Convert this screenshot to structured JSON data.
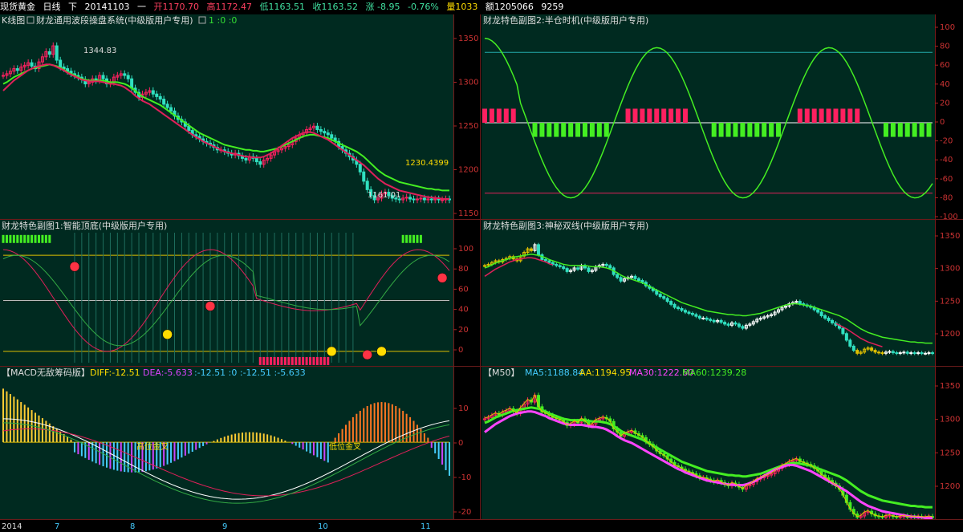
{
  "header": {
    "symbol": "现货黄金",
    "period": "日线",
    "direction": "下",
    "date": "20141103",
    "weekday": "一",
    "open": "开1170.70",
    "high": "高1172.47",
    "low": "低1163.51",
    "close": "收1163.52",
    "change": "涨 -8.95",
    "pct": "-0.76%",
    "volume": "量1033",
    "amount": "额1205066",
    "extra": "9259"
  },
  "colors": {
    "bg": "#000000",
    "panel_bg": "#002a20",
    "grid": "#7a1a1a",
    "axis_text": "#cc3333",
    "up": "#ff2060",
    "down": "#30e0c0",
    "green_line": "#44ee22",
    "red_line": "#e0205a",
    "yellow": "#e0c000",
    "cyan": "#44ccff",
    "magenta": "#dd44ff",
    "white": "#ffffff"
  },
  "panels": {
    "main": {
      "title": "K线图",
      "subtitle": "财龙通用波段操盘系统(中级版用户专用)",
      "params": "1 :0 :0",
      "yticks": [
        "1350",
        "1300",
        "1250",
        "1200",
        "1150"
      ],
      "annotations": [
        "1344.83",
        "1230.4399",
        "1161.01"
      ]
    },
    "sub1": {
      "title": "财龙特色副图1:智能顶底(中级版用户专用)",
      "yticks": [
        "100",
        "80",
        "60",
        "40",
        "20",
        "0"
      ]
    },
    "sub2": {
      "title": "财龙特色副图2:半仓时机(中级版用户专用)",
      "yticks": [
        "100",
        "80",
        "60",
        "40",
        "20",
        "0",
        "-20",
        "-40",
        "-60",
        "-80",
        "-100"
      ]
    },
    "sub3": {
      "title": "财龙特色副图3:神秘双线(中级版用户专用)",
      "yticks": [
        "1350",
        "1300",
        "1250",
        "1200"
      ]
    },
    "macd": {
      "title": "【MACD无敌筹码版】",
      "diff_label": "DIFF:-12.51",
      "dea_label": "DEA:-5.633",
      "macd_vals": ":-12.51 :0 :-12.51 :-5.633",
      "yticks": [
        "10",
        "0",
        "-10",
        "-20"
      ],
      "annotations": [
        "高位金叉",
        "低位金叉"
      ]
    },
    "ma": {
      "title": "【M50】",
      "ma5": "MA5:1188.84",
      "aa": "AA:1194.95",
      "ma30": "MA30:1222.60",
      "ma60": "MA60:1239.28",
      "yticks": [
        "1350",
        "1300",
        "1250",
        "1200"
      ]
    }
  },
  "xaxis": {
    "labels": [
      "2014",
      "7",
      "8",
      "9",
      "10",
      "11"
    ]
  },
  "chart_data": [
    {
      "type": "line",
      "name_ref": "main-candles",
      "title": "K线图",
      "ylim": [
        1145,
        1365
      ],
      "x": [
        0,
        1,
        2,
        3,
        4,
        5,
        6,
        7,
        8,
        9,
        10,
        11,
        12,
        13,
        14,
        15,
        16,
        17,
        18,
        19,
        20,
        21,
        22,
        23,
        24,
        25,
        26,
        27,
        28,
        29,
        30,
        31,
        32,
        33,
        34,
        35,
        36,
        37,
        38,
        39,
        40,
        41,
        42,
        43,
        44,
        45,
        46,
        47,
        48,
        49,
        50,
        51,
        52,
        53,
        54,
        55,
        56,
        57,
        58,
        59,
        60,
        61,
        62,
        63,
        64,
        65,
        66,
        67,
        68,
        69,
        70,
        71,
        72,
        73,
        74,
        75,
        76,
        77,
        78,
        79,
        80,
        81,
        82,
        83,
        84,
        85,
        86,
        87,
        88,
        89,
        90,
        91,
        92,
        93,
        94,
        95,
        96,
        97,
        98,
        99,
        100,
        101,
        102,
        103,
        104,
        105,
        106,
        107,
        108,
        109,
        110,
        111,
        112,
        113,
        114,
        115,
        116,
        117,
        118,
        119,
        120,
        121,
        122,
        123,
        124,
        125
      ],
      "close": [
        1310,
        1312,
        1315,
        1318,
        1316,
        1320,
        1322,
        1325,
        1321,
        1318,
        1326,
        1332,
        1338,
        1335,
        1345,
        1328,
        1320,
        1318,
        1315,
        1312,
        1310,
        1308,
        1305,
        1300,
        1302,
        1306,
        1304,
        1310,
        1306,
        1300,
        1302,
        1308,
        1310,
        1312,
        1310,
        1306,
        1295,
        1290,
        1284,
        1288,
        1290,
        1292,
        1288,
        1285,
        1282,
        1276,
        1272,
        1268,
        1262,
        1258,
        1255,
        1250,
        1245,
        1240,
        1238,
        1235,
        1232,
        1230,
        1228,
        1225,
        1222,
        1222,
        1220,
        1218,
        1216,
        1218,
        1215,
        1212,
        1210,
        1214,
        1212,
        1208,
        1205,
        1210,
        1212,
        1216,
        1220,
        1222,
        1224,
        1226,
        1228,
        1232,
        1236,
        1240,
        1242,
        1246,
        1248,
        1250,
        1246,
        1244,
        1242,
        1240,
        1236,
        1232,
        1226,
        1222,
        1218,
        1214,
        1210,
        1205,
        1196,
        1185,
        1175,
        1168,
        1163,
        1165,
        1170,
        1172,
        1168,
        1165,
        1164,
        1163,
        1165,
        1166,
        1164,
        1163,
        1164,
        1165,
        1163,
        1164,
        1163,
        1164,
        1163,
        1163,
        1164,
        1163
      ],
      "ma_green": [
        1300,
        1302,
        1305,
        1308,
        1310,
        1312,
        1314,
        1316,
        1318,
        1319,
        1320,
        1321,
        1322,
        1323,
        1322,
        1321,
        1319,
        1317,
        1314,
        1312,
        1310,
        1308,
        1306,
        1305,
        1304,
        1304,
        1304,
        1304,
        1304,
        1303,
        1302,
        1302,
        1302,
        1301,
        1300,
        1298,
        1295,
        1292,
        1288,
        1285,
        1283,
        1281,
        1279,
        1277,
        1275,
        1272,
        1269,
        1266,
        1263,
        1260,
        1257,
        1254,
        1251,
        1248,
        1245,
        1242,
        1240,
        1238,
        1236,
        1234,
        1232,
        1230,
        1228,
        1227,
        1226,
        1225,
        1224,
        1223,
        1222,
        1222,
        1221,
        1221,
        1220,
        1220,
        1221,
        1222,
        1223,
        1224,
        1226,
        1228,
        1230,
        1232,
        1234,
        1236,
        1238,
        1239,
        1240,
        1240,
        1239,
        1238,
        1237,
        1236,
        1234,
        1232,
        1230,
        1228,
        1226,
        1224,
        1222,
        1220,
        1217,
        1214,
        1210,
        1206,
        1202,
        1198,
        1195,
        1192,
        1190,
        1188,
        1186,
        1184,
        1183,
        1182,
        1181,
        1180,
        1179,
        1178,
        1177,
        1176,
        1176,
        1175,
        1175,
        1174,
        1174,
        1174
      ],
      "ma_red": [
        1292,
        1296,
        1300,
        1304,
        1307,
        1310,
        1313,
        1316,
        1318,
        1320,
        1321,
        1322,
        1323,
        1323,
        1322,
        1320,
        1318,
        1316,
        1313,
        1311,
        1309,
        1307,
        1305,
        1304,
        1303,
        1303,
        1303,
        1303,
        1302,
        1301,
        1300,
        1300,
        1299,
        1298,
        1296,
        1293,
        1290,
        1286,
        1283,
        1280,
        1278,
        1276,
        1273,
        1270,
        1267,
        1264,
        1261,
        1258,
        1255,
        1252,
        1249,
        1246,
        1243,
        1240,
        1237,
        1235,
        1232,
        1230,
        1228,
        1226,
        1224,
        1222,
        1220,
        1219,
        1218,
        1217,
        1216,
        1215,
        1214,
        1214,
        1213,
        1213,
        1213,
        1214,
        1216,
        1218,
        1221,
        1224,
        1227,
        1230,
        1233,
        1236,
        1238,
        1240,
        1242,
        1243,
        1243,
        1242,
        1240,
        1238,
        1236,
        1234,
        1231,
        1228,
        1225,
        1222,
        1219,
        1216,
        1213,
        1210,
        1207,
        1204,
        1200,
        1196,
        1192,
        1188,
        1185,
        1182,
        1180,
        1178,
        1176,
        1174,
        1173,
        1172,
        1171,
        1170,
        1169,
        1168,
        1167,
        1166,
        1166,
        1165,
        1165,
        1164,
        1164,
        1164
      ]
    }
  ]
}
